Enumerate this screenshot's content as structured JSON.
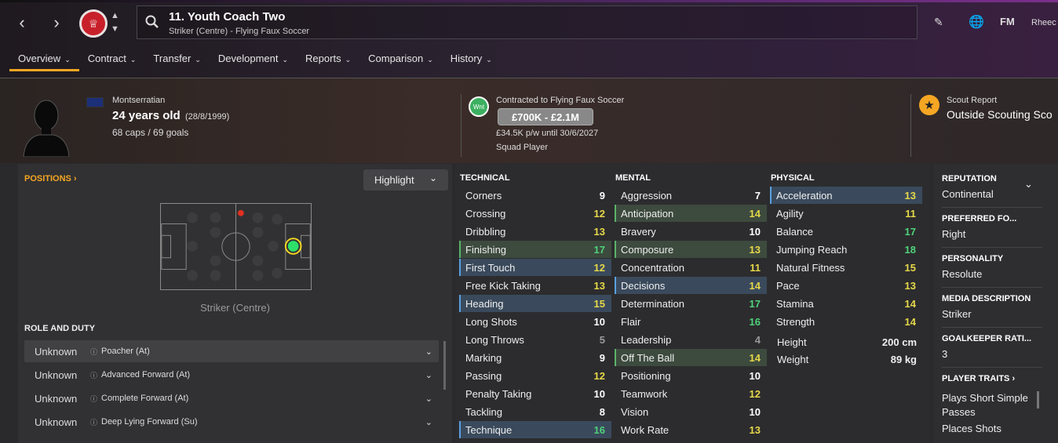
{
  "header": {
    "player_name": "11. Youth Coach Two",
    "player_sub": "Striker (Centre) - Flying Faux Soccer",
    "user_name": "Rheec",
    "fm_logo": "FM"
  },
  "tabs": [
    {
      "label": "Overview"
    },
    {
      "label": "Contract"
    },
    {
      "label": "Transfer"
    },
    {
      "label": "Development"
    },
    {
      "label": "Reports"
    },
    {
      "label": "Comparison"
    },
    {
      "label": "History"
    }
  ],
  "bio": {
    "nationality": "Montserratian",
    "age": "24 years old",
    "dob": "(28/8/1999)",
    "caps": "68 caps / 69 goals"
  },
  "contract": {
    "wnt": "Wnt",
    "contracted": "Contracted to Flying Faux Soccer",
    "value": "£700K - £2.1M",
    "wage": "£34.5K p/w until 30/6/2027",
    "status": "Squad Player"
  },
  "scout": {
    "label": "Scout Report",
    "value": "Outside Scouting Sco"
  },
  "positions": {
    "heading": "POSITIONS",
    "highlight": "Highlight",
    "position_label": "Striker (Centre)"
  },
  "roles": {
    "heading": "ROLE AND DUTY",
    "items": [
      {
        "rating": "Unknown",
        "role": "Poacher (At)"
      },
      {
        "rating": "Unknown",
        "role": "Advanced Forward (At)"
      },
      {
        "rating": "Unknown",
        "role": "Complete Forward (At)"
      },
      {
        "rating": "Unknown",
        "role": "Deep Lying Forward (Su)"
      }
    ]
  },
  "attributes": {
    "technical_heading": "TECHNICAL",
    "mental_heading": "MENTAL",
    "physical_heading": "PHYSICAL",
    "technical": [
      {
        "name": "Corners",
        "value": "9",
        "hl": ""
      },
      {
        "name": "Crossing",
        "value": "12",
        "hl": ""
      },
      {
        "name": "Dribbling",
        "value": "13",
        "hl": ""
      },
      {
        "name": "Finishing",
        "value": "17",
        "hl": "green"
      },
      {
        "name": "First Touch",
        "value": "12",
        "hl": "blue"
      },
      {
        "name": "Free Kick Taking",
        "value": "13",
        "hl": ""
      },
      {
        "name": "Heading",
        "value": "15",
        "hl": "blue"
      },
      {
        "name": "Long Shots",
        "value": "10",
        "hl": ""
      },
      {
        "name": "Long Throws",
        "value": "5",
        "hl": ""
      },
      {
        "name": "Marking",
        "value": "9",
        "hl": ""
      },
      {
        "name": "Passing",
        "value": "12",
        "hl": ""
      },
      {
        "name": "Penalty Taking",
        "value": "10",
        "hl": ""
      },
      {
        "name": "Tackling",
        "value": "8",
        "hl": ""
      },
      {
        "name": "Technique",
        "value": "16",
        "hl": "blue"
      }
    ],
    "mental": [
      {
        "name": "Aggression",
        "value": "7",
        "hl": ""
      },
      {
        "name": "Anticipation",
        "value": "14",
        "hl": "green"
      },
      {
        "name": "Bravery",
        "value": "10",
        "hl": ""
      },
      {
        "name": "Composure",
        "value": "13",
        "hl": "green"
      },
      {
        "name": "Concentration",
        "value": "11",
        "hl": ""
      },
      {
        "name": "Decisions",
        "value": "14",
        "hl": "blue"
      },
      {
        "name": "Determination",
        "value": "17",
        "hl": ""
      },
      {
        "name": "Flair",
        "value": "16",
        "hl": ""
      },
      {
        "name": "Leadership",
        "value": "4",
        "hl": ""
      },
      {
        "name": "Off The Ball",
        "value": "14",
        "hl": "green"
      },
      {
        "name": "Positioning",
        "value": "10",
        "hl": ""
      },
      {
        "name": "Teamwork",
        "value": "12",
        "hl": ""
      },
      {
        "name": "Vision",
        "value": "10",
        "hl": ""
      },
      {
        "name": "Work Rate",
        "value": "13",
        "hl": ""
      }
    ],
    "physical": [
      {
        "name": "Acceleration",
        "value": "13",
        "hl": "blue"
      },
      {
        "name": "Agility",
        "value": "11",
        "hl": ""
      },
      {
        "name": "Balance",
        "value": "17",
        "hl": ""
      },
      {
        "name": "Jumping Reach",
        "value": "18",
        "hl": ""
      },
      {
        "name": "Natural Fitness",
        "value": "15",
        "hl": ""
      },
      {
        "name": "Pace",
        "value": "13",
        "hl": ""
      },
      {
        "name": "Stamina",
        "value": "14",
        "hl": ""
      },
      {
        "name": "Strength",
        "value": "14",
        "hl": ""
      }
    ],
    "height_label": "Height",
    "height_value": "200 cm",
    "weight_label": "Weight",
    "weight_value": "89 kg"
  },
  "side": {
    "reputation_h": "REPUTATION",
    "reputation_v": "Continental",
    "foot_h": "PREFERRED FO...",
    "foot_v": "Right",
    "personality_h": "PERSONALITY",
    "personality_v": "Resolute",
    "media_h": "MEDIA DESCRIPTION",
    "media_v": "Striker",
    "gk_h": "GOALKEEPER RATI...",
    "gk_v": "3",
    "traits_h": "PLAYER TRAITS",
    "trait1": "Plays Short Simple Passes",
    "trait2": "Places Shots"
  },
  "colors": {
    "accent": "#f5a623",
    "value_white": "#ffffff",
    "value_yellow": "#e6d84a",
    "value_green": "#4fd27a",
    "value_grey": "#9a9a9a"
  }
}
